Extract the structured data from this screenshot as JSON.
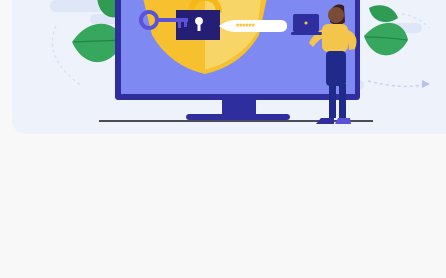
{
  "illustration": {
    "password_mask": "******",
    "colors": {
      "background": "#f8f8f9",
      "card": "#eef2fb",
      "monitor_frame": "#2f2e9f",
      "screen": "#7e89f2",
      "shield": "#f6c02f",
      "shield_inner": "#f8d567",
      "key": "#5b52d8",
      "lock": "#241f75",
      "leaf": "#3eaa62",
      "person_shirt": "#f3c54a",
      "person_pants": "#1f2a8a",
      "laptop": "#2f2e9f"
    }
  }
}
